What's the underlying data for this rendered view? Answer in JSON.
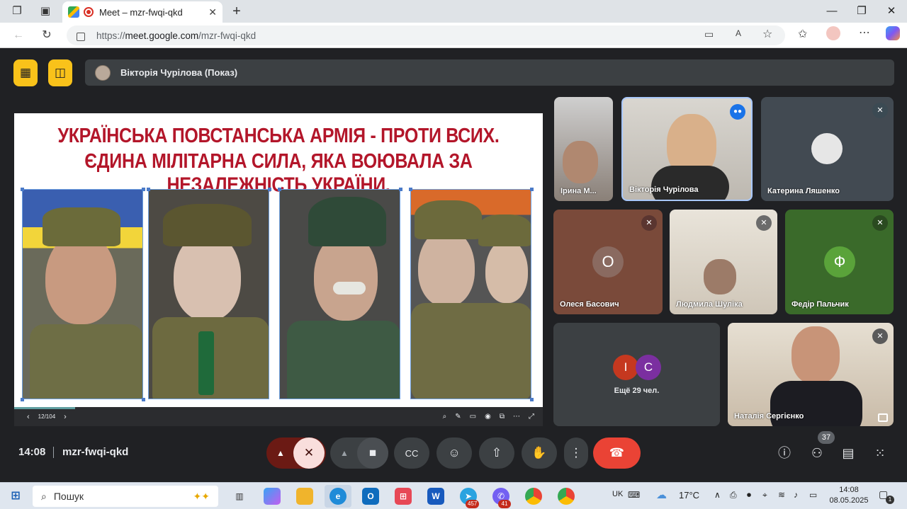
{
  "browser": {
    "tab_title": "Meet – mzr-fwqi-qkd",
    "tab_close": "✕",
    "new_tab": "+",
    "url_scheme": "https://",
    "url_host": "meet.google.com",
    "url_path": "/mzr-fwqi-qkd"
  },
  "meet": {
    "presenter_label": "Вікторія Чурілова (Показ)",
    "slide": {
      "title_line1": "УКРАЇНСЬКА ПОВСТАНСЬКА АРМІЯ -  ПРОТИ ВСИХ.",
      "title_line2": "ЄДИНА МІЛІТАРНА СИЛА, ЯКА ВОЮВАЛА ЗА НЕЗАЛЕЖНІСТЬ УКРАЇНИ.",
      "page_indicator": "12/104",
      "progress_fraction": 0.115
    },
    "participants": [
      {
        "name": "Ірина М...",
        "muted": false
      },
      {
        "name": "Вікторія Чурілова",
        "speaking": true
      },
      {
        "name": "Катерина Ляшенко",
        "muted": true
      },
      {
        "name": "Олеся Басович",
        "avatar_letter": "О",
        "muted": true
      },
      {
        "name": "Людмила Шуліка",
        "muted": true
      },
      {
        "name": "Федір Пальчик",
        "avatar_letter": "Ф",
        "muted": true
      },
      {
        "name": "Наталія Сергієнко",
        "muted": true
      }
    ],
    "others": {
      "avatar1": "І",
      "avatar2": "С",
      "label": "Ещё 29 чел."
    },
    "controls": {
      "time": "14:08",
      "meeting_code": "mzr-fwqi-qkd",
      "participants_count": "37"
    }
  },
  "taskbar": {
    "search_placeholder": "Пошук",
    "telegram_badge": "457",
    "viber_badge": "41",
    "lang": "UK",
    "temperature": "17°C",
    "clock_time": "14:08",
    "clock_date": "08.05.2025",
    "notif_count": "1"
  },
  "colors": {
    "accent_yellow": "#f9c21a",
    "end_call_red": "#ea4335",
    "title_red": "#b3162a",
    "tile_bg": "#3c4043",
    "meet_bg": "#202124"
  }
}
